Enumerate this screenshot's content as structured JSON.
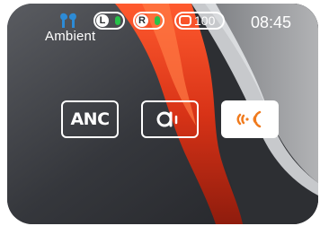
{
  "status": {
    "mode_label": "Ambient",
    "left_bud": {
      "letter": "L",
      "color": "#27c24a"
    },
    "right_bud": {
      "letter": "R",
      "color": "#27c24a"
    },
    "case_battery": "100",
    "time": "08:45",
    "icons": [
      "earbuds-icon",
      "battery-icon",
      "case-icon"
    ]
  },
  "controls": {
    "anc_label": "ANC",
    "items": [
      {
        "name": "anc-button",
        "icon": "anc-text",
        "active": false
      },
      {
        "name": "transparency-button",
        "icon": "transparency-icon",
        "active": false
      },
      {
        "name": "ambient-button",
        "icon": "ambient-sound-icon",
        "active": true
      }
    ]
  },
  "colors": {
    "accent": "#f07b1e",
    "active_background": "#ffffff",
    "earbud_icon": "#2d8bd6"
  }
}
